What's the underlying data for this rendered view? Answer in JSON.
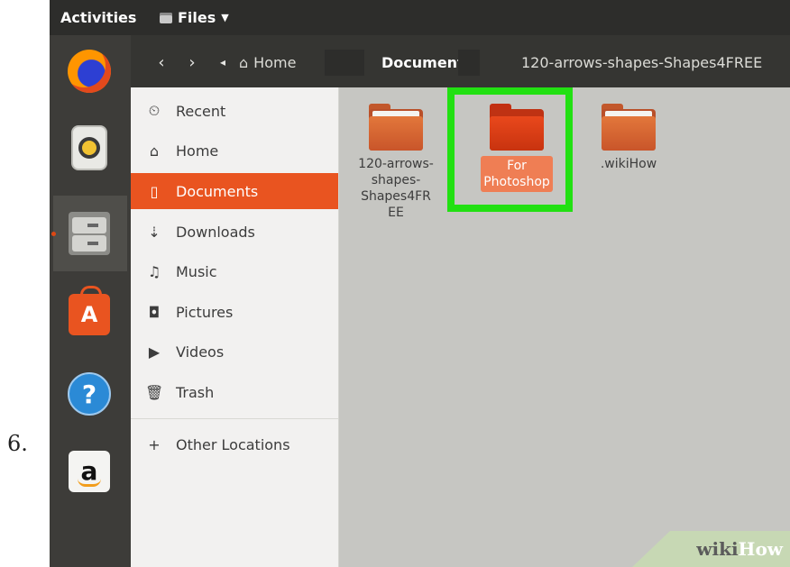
{
  "step": {
    "number": "6."
  },
  "topbar": {
    "activities": "Activities",
    "app_menu": "Files"
  },
  "dock": {
    "items": [
      {
        "name": "Firefox",
        "icon": "firefox-icon"
      },
      {
        "name": "Rhythmbox",
        "icon": "speaker-icon"
      },
      {
        "name": "Files",
        "icon": "file-cabinet-icon",
        "active": true
      },
      {
        "name": "Ubuntu Software",
        "icon": "shopping-bag-icon",
        "glyph": "A"
      },
      {
        "name": "Help",
        "icon": "help-icon",
        "glyph": "?"
      },
      {
        "name": "Amazon",
        "icon": "amazon-icon",
        "glyph": "a"
      }
    ]
  },
  "pathbar": {
    "crumbs": [
      "Home",
      "Documents",
      "120-arrows-shapes-Shapes4FREE"
    ],
    "active": "Documents"
  },
  "sidebar": {
    "items": [
      {
        "label": "Recent",
        "icon": "clock-icon",
        "glyph": "⏲"
      },
      {
        "label": "Home",
        "icon": "home-icon",
        "glyph": "⌂"
      },
      {
        "label": "Documents",
        "icon": "document-icon",
        "glyph": "▯",
        "selected": true
      },
      {
        "label": "Downloads",
        "icon": "download-icon",
        "glyph": "⇣"
      },
      {
        "label": "Music",
        "icon": "music-icon",
        "glyph": "♫"
      },
      {
        "label": "Pictures",
        "icon": "camera-icon",
        "glyph": "◘"
      },
      {
        "label": "Videos",
        "icon": "video-icon",
        "glyph": "▶"
      },
      {
        "label": "Trash",
        "icon": "trash-icon",
        "glyph": "🗑"
      },
      {
        "label": "Other Locations",
        "icon": "plus-icon",
        "glyph": "+"
      }
    ]
  },
  "content": {
    "folders": [
      {
        "label_lines": [
          "120-arrows-",
          "shapes-",
          "Shapes4FR",
          "EE"
        ],
        "selected": false
      },
      {
        "label_lines": [
          "For",
          "Photoshop"
        ],
        "selected": true
      },
      {
        "label_lines": [
          ".wikiHow"
        ],
        "selected": false
      }
    ]
  },
  "watermark": {
    "wiki": "wiki",
    "how": "How"
  },
  "colors": {
    "accent": "#e95420",
    "highlight": "#22e012",
    "topbar": "#2d2d2b",
    "dock": "#3d3c39"
  }
}
